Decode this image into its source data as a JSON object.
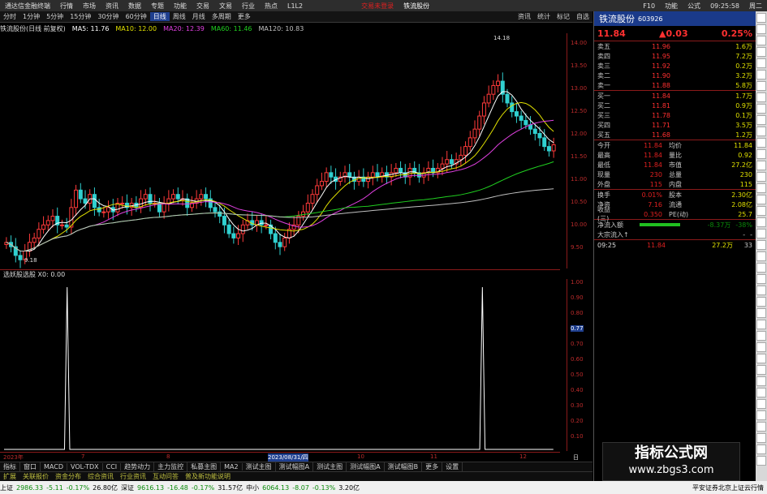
{
  "titlebar": {
    "app": "通达信金融终端",
    "menu": [
      "行情",
      "市场",
      "资讯",
      "数据",
      "专题",
      "功能",
      "交易",
      "文易",
      "行业",
      "热点",
      "L1L2"
    ],
    "center": [
      "交易未登录",
      "铁流股份"
    ],
    "tools": [
      "资讯",
      "资讯",
      "统计",
      "F10",
      "标记",
      "功能",
      "公式"
    ],
    "time": "09:25:58",
    "weekday": "周二"
  },
  "toolbar": {
    "items": [
      "分时",
      "1分钟",
      "5分钟",
      "15分钟",
      "30分钟",
      "60分钟",
      "日线",
      "周线",
      "月线",
      "多周期",
      "更多"
    ],
    "active": "日线",
    "right": [
      "资讯",
      "统计",
      "标记",
      "自选"
    ]
  },
  "main_legend": {
    "title": "铁流股份(日线 前复权)",
    "ma5": "MA5: 11.76",
    "ma10": "MA10: 12.00",
    "ma20": "MA20: 12.39",
    "ma60": "MA60: 11.46",
    "ma120": "MA120: 10.83"
  },
  "sub_legend": {
    "title": "选妖股选股 X0: 0.00"
  },
  "annotations": {
    "high": "14.18",
    "low": "9.18"
  },
  "yaxis_main": [
    "14.00",
    "13.50",
    "13.00",
    "12.50",
    "12.00",
    "11.50",
    "11.00",
    "10.50",
    "10.00",
    "9.50"
  ],
  "yaxis_sub": [
    "1.00",
    "0.90",
    "0.80",
    "0.77",
    "0.70",
    "0.60",
    "0.50",
    "0.40",
    "0.30",
    "0.20",
    "0.10"
  ],
  "xaxis": [
    "2023年",
    "7",
    "8",
    "2023/08/31/四",
    "10",
    "11",
    "12",
    "日线"
  ],
  "indicator_tabs": [
    "指标",
    "窗口",
    "MACD",
    "VOL-TDX",
    "CCI",
    "趋势动力",
    "主力监控",
    "私募主图",
    "MA2",
    "测试主图",
    "测试幅图A",
    "测试主图",
    "测试幅图A",
    "测试幅图B",
    "更多",
    "设置"
  ],
  "info_tabs": [
    "扩展",
    "关联报价",
    "资金分布",
    "综合资讯",
    "行业资讯",
    "互动问答",
    "普及新功能说明"
  ],
  "statusbar": [
    {
      "label": "上证",
      "value": "2986.33",
      "chg": "-5.11",
      "pct": "-0.17%",
      "amt": "26.80亿"
    },
    {
      "label": "深证",
      "value": "9616.13",
      "chg": "-16.48",
      "pct": "-0.17%",
      "amt": "31.57亿"
    },
    {
      "label": "中小",
      "value": "6064.13",
      "chg": "-8.07",
      "pct": "-0.13%",
      "amt": "3.20亿"
    }
  ],
  "status_right": "平安证券北京上证云行情",
  "quote": {
    "name": "铁流股份",
    "code": "603926",
    "price": "11.84",
    "change": "▲0.03",
    "pct": "0.25%",
    "asks": [
      {
        "label": "卖五",
        "price": "11.96",
        "vol": "1.6万"
      },
      {
        "label": "卖四",
        "price": "11.95",
        "vol": "7.2万"
      },
      {
        "label": "卖三",
        "price": "11.92",
        "vol": "0.2万"
      },
      {
        "label": "卖二",
        "price": "11.90",
        "vol": "3.2万"
      },
      {
        "label": "卖一",
        "price": "11.88",
        "vol": "5.8万"
      }
    ],
    "bids": [
      {
        "label": "买一",
        "price": "11.84",
        "vol": "1.7万"
      },
      {
        "label": "买二",
        "price": "11.81",
        "vol": "0.9万"
      },
      {
        "label": "买三",
        "price": "11.78",
        "vol": "0.1万"
      },
      {
        "label": "买四",
        "price": "11.71",
        "vol": "3.5万"
      },
      {
        "label": "买五",
        "price": "11.68",
        "vol": "1.2万"
      }
    ],
    "stats": [
      {
        "k": "今开",
        "v": "11.84",
        "k2": "均价",
        "v2": "11.84"
      },
      {
        "k": "最高",
        "v": "11.84",
        "k2": "量比",
        "v2": "0.92"
      },
      {
        "k": "最低",
        "v": "11.84",
        "k2": "市值",
        "v2": "27.2亿"
      },
      {
        "k": "现量",
        "v": "230",
        "k2": "总量",
        "v2": "230"
      },
      {
        "k": "外盘",
        "v": "115",
        "k2": "内盘",
        "v2": "115"
      }
    ],
    "stats2": [
      {
        "k": "换手",
        "v": "0.01%",
        "k2": "股本",
        "v2": "2.30亿"
      },
      {
        "k": "净资",
        "v": "7.16",
        "k2": "流通",
        "v2": "2.08亿"
      },
      {
        "k": "收益(三)",
        "v": "0.350",
        "k2": "PE(动)",
        "v2": "25.7"
      }
    ],
    "flow": [
      {
        "k": "净流入额",
        "v": "-8.37万",
        "pct": "-38%"
      },
      {
        "k": "大宗流入↑",
        "v": "-",
        "pct": "-"
      }
    ],
    "tick": {
      "time": "09:25",
      "price": "11.84",
      "vol": "27.2万",
      "n": "33"
    }
  },
  "watermark": {
    "line1": "指标公式网",
    "line2": "www.zbgs3.com"
  },
  "chart_data": {
    "type": "candlestick",
    "ylim": [
      9.0,
      14.4
    ],
    "closes": [
      9.6,
      9.5,
      9.3,
      9.2,
      9.4,
      9.6,
      9.7,
      9.9,
      10.0,
      10.1,
      10.2,
      10.0,
      10.0,
      9.95,
      10.4,
      10.8,
      10.6,
      10.5,
      10.7,
      10.4,
      10.3,
      10.3,
      10.4,
      10.3,
      10.5,
      10.5,
      10.4,
      10.5,
      10.4,
      10.6,
      10.7,
      10.5,
      10.5,
      10.3,
      10.5,
      10.6,
      10.7,
      10.6,
      10.6,
      10.4,
      10.5,
      10.6,
      10.7,
      10.6,
      10.4,
      10.3,
      10.2,
      10.0,
      9.8,
      9.7,
      9.8,
      10.0,
      10.1,
      10.0,
      10.1,
      10.0,
      10.0,
      9.8,
      9.6,
      9.5,
      9.7,
      9.9,
      10.0,
      10.2,
      10.3,
      10.5,
      10.7,
      10.9,
      11.0,
      11.2,
      11.1,
      11.0,
      11.1,
      11.2,
      11.1,
      11.0,
      11.1,
      11.0,
      11.1,
      11.2,
      11.1,
      11.2,
      11.1,
      11.2,
      11.3,
      11.2,
      11.1,
      11.3,
      11.2,
      11.1,
      11.2,
      11.3,
      11.2,
      11.3,
      11.4,
      11.5,
      11.4,
      11.5,
      11.6,
      11.8,
      12.0,
      12.2,
      12.5,
      12.8,
      13.0,
      13.2,
      13.3,
      13.0,
      12.8,
      12.6,
      12.5,
      12.4,
      12.3,
      12.2,
      12.1,
      12.0,
      11.8,
      11.7,
      11.84
    ],
    "sub_series": {
      "name": "X0",
      "spikes_at": [
        24,
        182
      ],
      "total": 210,
      "ylim": [
        0,
        1.0
      ]
    }
  }
}
